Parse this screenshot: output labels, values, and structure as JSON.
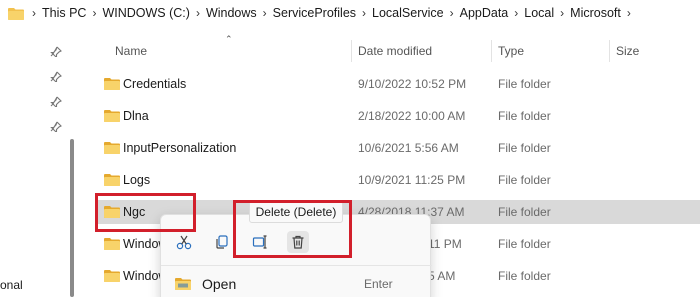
{
  "breadcrumb": {
    "items": [
      "This PC",
      "WINDOWS (C:)",
      "Windows",
      "ServiceProfiles",
      "LocalService",
      "AppData",
      "Local",
      "Microsoft"
    ]
  },
  "nav": {
    "partial_label": "onal"
  },
  "columns": {
    "name": "Name",
    "date": "Date modified",
    "type": "Type",
    "size": "Size"
  },
  "files": [
    {
      "name": "Credentials",
      "date": "9/10/2022 10:52 PM",
      "type": "File folder"
    },
    {
      "name": "Dlna",
      "date": "2/18/2022 10:00 AM",
      "type": "File folder"
    },
    {
      "name": "InputPersonalization",
      "date": "10/6/2021 5:56 AM",
      "type": "File folder"
    },
    {
      "name": "Logs",
      "date": "10/9/2021 11:25 PM",
      "type": "File folder"
    },
    {
      "name": "Ngc",
      "date": "4/28/2018 11:37 AM",
      "type": "File folder"
    },
    {
      "name": "Window",
      "date": "11 PM",
      "type": "File folder"
    },
    {
      "name": "Window",
      "date": "5 AM",
      "type": "File folder"
    }
  ],
  "context_menu": {
    "icons": [
      "cut-icon",
      "copy-icon",
      "rename-icon",
      "delete-icon"
    ],
    "tooltip": "Delete (Delete)",
    "item_open_label": "Open",
    "item_open_shortcut": "Enter"
  },
  "colors": {
    "folder": "#f2c14e",
    "highlight": "#d21f2b",
    "selected_row": "#d9d9d9"
  }
}
